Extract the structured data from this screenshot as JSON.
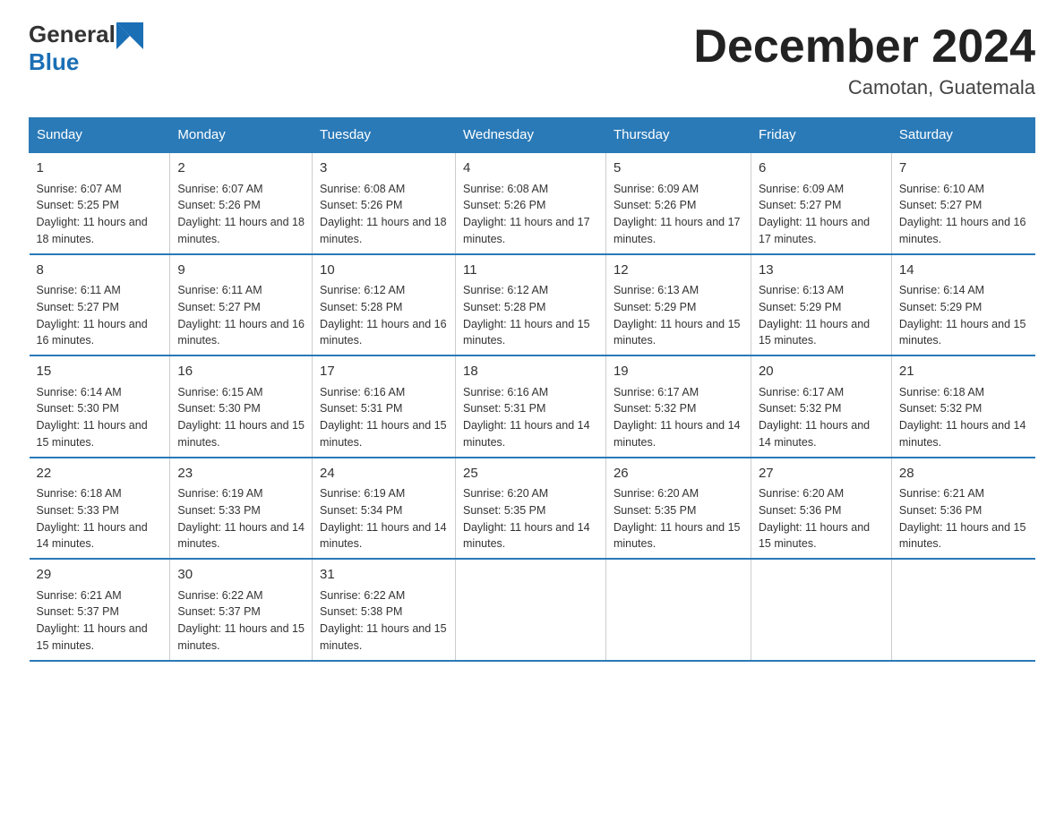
{
  "logo": {
    "text_general": "General",
    "text_blue": "Blue"
  },
  "header": {
    "title": "December 2024",
    "subtitle": "Camotan, Guatemala"
  },
  "days_of_week": [
    "Sunday",
    "Monday",
    "Tuesday",
    "Wednesday",
    "Thursday",
    "Friday",
    "Saturday"
  ],
  "weeks": [
    [
      {
        "day": "1",
        "sunrise": "6:07 AM",
        "sunset": "5:25 PM",
        "daylight": "11 hours and 18 minutes."
      },
      {
        "day": "2",
        "sunrise": "6:07 AM",
        "sunset": "5:26 PM",
        "daylight": "11 hours and 18 minutes."
      },
      {
        "day": "3",
        "sunrise": "6:08 AM",
        "sunset": "5:26 PM",
        "daylight": "11 hours and 18 minutes."
      },
      {
        "day": "4",
        "sunrise": "6:08 AM",
        "sunset": "5:26 PM",
        "daylight": "11 hours and 17 minutes."
      },
      {
        "day": "5",
        "sunrise": "6:09 AM",
        "sunset": "5:26 PM",
        "daylight": "11 hours and 17 minutes."
      },
      {
        "day": "6",
        "sunrise": "6:09 AM",
        "sunset": "5:27 PM",
        "daylight": "11 hours and 17 minutes."
      },
      {
        "day": "7",
        "sunrise": "6:10 AM",
        "sunset": "5:27 PM",
        "daylight": "11 hours and 16 minutes."
      }
    ],
    [
      {
        "day": "8",
        "sunrise": "6:11 AM",
        "sunset": "5:27 PM",
        "daylight": "11 hours and 16 minutes."
      },
      {
        "day": "9",
        "sunrise": "6:11 AM",
        "sunset": "5:27 PM",
        "daylight": "11 hours and 16 minutes."
      },
      {
        "day": "10",
        "sunrise": "6:12 AM",
        "sunset": "5:28 PM",
        "daylight": "11 hours and 16 minutes."
      },
      {
        "day": "11",
        "sunrise": "6:12 AM",
        "sunset": "5:28 PM",
        "daylight": "11 hours and 15 minutes."
      },
      {
        "day": "12",
        "sunrise": "6:13 AM",
        "sunset": "5:29 PM",
        "daylight": "11 hours and 15 minutes."
      },
      {
        "day": "13",
        "sunrise": "6:13 AM",
        "sunset": "5:29 PM",
        "daylight": "11 hours and 15 minutes."
      },
      {
        "day": "14",
        "sunrise": "6:14 AM",
        "sunset": "5:29 PM",
        "daylight": "11 hours and 15 minutes."
      }
    ],
    [
      {
        "day": "15",
        "sunrise": "6:14 AM",
        "sunset": "5:30 PM",
        "daylight": "11 hours and 15 minutes."
      },
      {
        "day": "16",
        "sunrise": "6:15 AM",
        "sunset": "5:30 PM",
        "daylight": "11 hours and 15 minutes."
      },
      {
        "day": "17",
        "sunrise": "6:16 AM",
        "sunset": "5:31 PM",
        "daylight": "11 hours and 15 minutes."
      },
      {
        "day": "18",
        "sunrise": "6:16 AM",
        "sunset": "5:31 PM",
        "daylight": "11 hours and 14 minutes."
      },
      {
        "day": "19",
        "sunrise": "6:17 AM",
        "sunset": "5:32 PM",
        "daylight": "11 hours and 14 minutes."
      },
      {
        "day": "20",
        "sunrise": "6:17 AM",
        "sunset": "5:32 PM",
        "daylight": "11 hours and 14 minutes."
      },
      {
        "day": "21",
        "sunrise": "6:18 AM",
        "sunset": "5:32 PM",
        "daylight": "11 hours and 14 minutes."
      }
    ],
    [
      {
        "day": "22",
        "sunrise": "6:18 AM",
        "sunset": "5:33 PM",
        "daylight": "11 hours and 14 minutes."
      },
      {
        "day": "23",
        "sunrise": "6:19 AM",
        "sunset": "5:33 PM",
        "daylight": "11 hours and 14 minutes."
      },
      {
        "day": "24",
        "sunrise": "6:19 AM",
        "sunset": "5:34 PM",
        "daylight": "11 hours and 14 minutes."
      },
      {
        "day": "25",
        "sunrise": "6:20 AM",
        "sunset": "5:35 PM",
        "daylight": "11 hours and 14 minutes."
      },
      {
        "day": "26",
        "sunrise": "6:20 AM",
        "sunset": "5:35 PM",
        "daylight": "11 hours and 15 minutes."
      },
      {
        "day": "27",
        "sunrise": "6:20 AM",
        "sunset": "5:36 PM",
        "daylight": "11 hours and 15 minutes."
      },
      {
        "day": "28",
        "sunrise": "6:21 AM",
        "sunset": "5:36 PM",
        "daylight": "11 hours and 15 minutes."
      }
    ],
    [
      {
        "day": "29",
        "sunrise": "6:21 AM",
        "sunset": "5:37 PM",
        "daylight": "11 hours and 15 minutes."
      },
      {
        "day": "30",
        "sunrise": "6:22 AM",
        "sunset": "5:37 PM",
        "daylight": "11 hours and 15 minutes."
      },
      {
        "day": "31",
        "sunrise": "6:22 AM",
        "sunset": "5:38 PM",
        "daylight": "11 hours and 15 minutes."
      },
      null,
      null,
      null,
      null
    ]
  ],
  "colors": {
    "header_bg": "#2a7ab8",
    "header_text": "#ffffff",
    "border": "#2a7ab8",
    "cell_border": "#cccccc"
  }
}
